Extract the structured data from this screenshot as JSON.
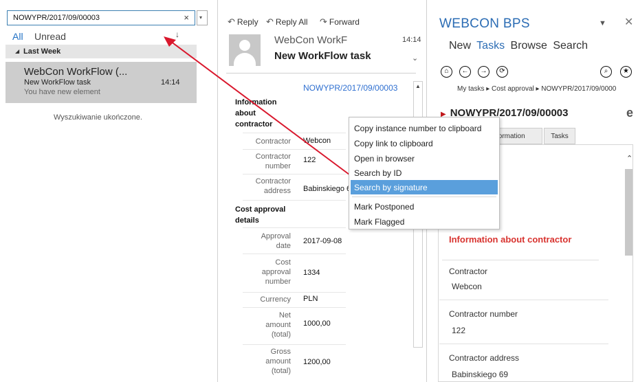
{
  "search": {
    "value": "NOWYPR/2017/09/00003",
    "clear_icon": "×",
    "dropdown_icon": "▾"
  },
  "filters": {
    "all": "All",
    "unread": "Unread",
    "sort_icon": "↓"
  },
  "mail_list": {
    "group_header": "Last Week",
    "item": {
      "from": "WebCon WorkFlow (...",
      "subject": "New WorkFlow task",
      "time": "14:14",
      "preview": "You have new element"
    },
    "status": "Wyszukiwanie ukończone."
  },
  "reading_pane": {
    "toolbar": {
      "reply": "Reply",
      "reply_all": "Reply All",
      "forward": "Forward"
    },
    "header": {
      "from": "WebCon WorkF",
      "time": "14:14",
      "subject": "New WorkFlow task"
    },
    "body": {
      "signature": "NOWYPR/2017/09/00003",
      "section_contractor": "Information about contractor",
      "contractor_label": "Contractor",
      "contractor_value": "Webcon",
      "contractor_number_label": "Contractor number",
      "contractor_number_value": "122",
      "contractor_address_label": "Contractor address",
      "contractor_address_value": "Babinskiego 69",
      "section_cost": "Cost approval details",
      "approval_date_label": "Approval date",
      "approval_date_value": "2017-09-08",
      "cost_approval_number_label": "Cost approval number",
      "cost_approval_number_value": "1334",
      "currency_label": "Currency",
      "currency_value": "PLN",
      "net_amount_label": "Net amount (total)",
      "net_amount_value": "1000,00",
      "gross_amount_label": "Gross amount (total)",
      "gross_amount_value": "1200,00"
    }
  },
  "context_menu": {
    "items": [
      "Copy instance number to clipboard",
      "Copy link to clipboard",
      "Open in browser",
      "Search by ID",
      "Search by signature",
      "Mark Postponed",
      "Mark Flagged"
    ],
    "highlighted_index": 4
  },
  "webcon_pane": {
    "title": "WEBCON BPS",
    "nav": [
      "New",
      "Tasks",
      "Browse",
      "Search"
    ],
    "active_nav": "Tasks",
    "breadcrumb": "My tasks ▸ Cost approval ▸ NOWYPR/2017/09/0000",
    "instance": "NOWYPR/2017/09/00003",
    "tabs": {
      "information": "formation",
      "tasks": "Tasks"
    },
    "section_title": "Information about contractor",
    "fields": [
      {
        "label": "Contractor",
        "value": "Webcon"
      },
      {
        "label": "Contractor number",
        "value": "122"
      },
      {
        "label": "Contractor address",
        "value": "Babinskiego 69"
      }
    ]
  },
  "colors": {
    "accent_blue": "#2b6cb4",
    "menu_highlight": "#5a9fdc",
    "arrow_red": "#d9182d",
    "section_red": "#d8332f"
  }
}
